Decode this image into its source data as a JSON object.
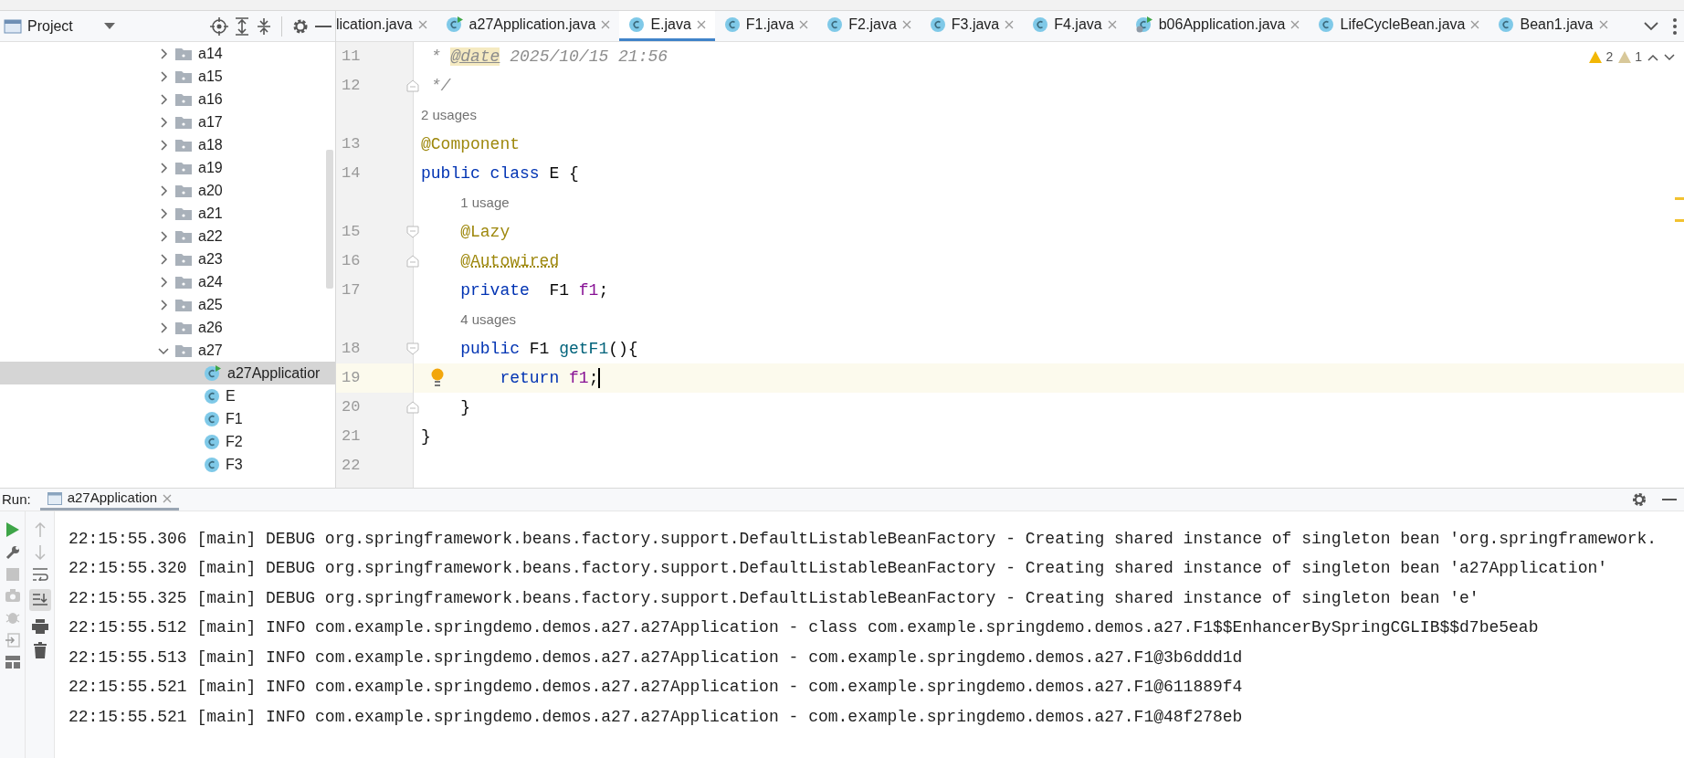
{
  "project": {
    "title": "Project",
    "tree": [
      {
        "label": "a14",
        "kind": "folder",
        "expanded": false,
        "selected": false
      },
      {
        "label": "a15",
        "kind": "folder",
        "expanded": false,
        "selected": false
      },
      {
        "label": "a16",
        "kind": "folder",
        "expanded": false,
        "selected": false
      },
      {
        "label": "a17",
        "kind": "folder",
        "expanded": false,
        "selected": false
      },
      {
        "label": "a18",
        "kind": "folder",
        "expanded": false,
        "selected": false
      },
      {
        "label": "a19",
        "kind": "folder",
        "expanded": false,
        "selected": false
      },
      {
        "label": "a20",
        "kind": "folder",
        "expanded": false,
        "selected": false
      },
      {
        "label": "a21",
        "kind": "folder",
        "expanded": false,
        "selected": false
      },
      {
        "label": "a22",
        "kind": "folder",
        "expanded": false,
        "selected": false
      },
      {
        "label": "a23",
        "kind": "folder",
        "expanded": false,
        "selected": false
      },
      {
        "label": "a24",
        "kind": "folder",
        "expanded": false,
        "selected": false
      },
      {
        "label": "a25",
        "kind": "folder",
        "expanded": false,
        "selected": false
      },
      {
        "label": "a26",
        "kind": "folder",
        "expanded": false,
        "selected": false
      },
      {
        "label": "a27",
        "kind": "folder",
        "expanded": true,
        "selected": false,
        "children": [
          {
            "label": "a27Applicatior",
            "kind": "app",
            "selected": true
          },
          {
            "label": "E",
            "kind": "class",
            "selected": false
          },
          {
            "label": "F1",
            "kind": "class",
            "selected": false
          },
          {
            "label": "F2",
            "kind": "class",
            "selected": false
          },
          {
            "label": "F3",
            "kind": "class",
            "selected": false
          }
        ]
      }
    ]
  },
  "editor": {
    "tabs": [
      {
        "label": "lication.java",
        "kind": "none",
        "selected": false
      },
      {
        "label": "a27Application.java",
        "kind": "app",
        "selected": false
      },
      {
        "label": "E.java",
        "kind": "class",
        "selected": true
      },
      {
        "label": "F1.java",
        "kind": "class",
        "selected": false
      },
      {
        "label": "F2.java",
        "kind": "class",
        "selected": false
      },
      {
        "label": "F3.java",
        "kind": "class",
        "selected": false
      },
      {
        "label": "F4.java",
        "kind": "class",
        "selected": false
      },
      {
        "label": "b06Application.java",
        "kind": "boot-app",
        "selected": false
      },
      {
        "label": "LifeCycleBean.java",
        "kind": "class",
        "selected": false
      },
      {
        "label": "Bean1.java",
        "kind": "class",
        "selected": false
      }
    ],
    "inspections": [
      {
        "kind": "warning",
        "count": "2"
      },
      {
        "kind": "weak",
        "count": "1"
      }
    ],
    "lines": [
      {
        "number": "11",
        "current": false,
        "fold_start": false,
        "fold_end": false,
        "tokens": [
          {
            "kind": "doc",
            "text": " * "
          },
          {
            "kind": "doctag",
            "text": "@date"
          },
          {
            "kind": "doc",
            "text": " 2025/10/15 21:56"
          }
        ]
      },
      {
        "number": "12",
        "current": false,
        "fold_start": false,
        "fold_end": true,
        "tokens": [
          {
            "kind": "doc",
            "text": " */"
          }
        ]
      },
      {
        "number": "13",
        "current": false,
        "fold_start": false,
        "fold_end": false,
        "usages": "2 usages",
        "tokens": [
          {
            "kind": "annotation",
            "text": "@Component"
          }
        ]
      },
      {
        "number": "14",
        "current": false,
        "fold_start": false,
        "fold_end": false,
        "tokens": [
          {
            "kind": "keyword",
            "text": "public class "
          },
          {
            "kind": "plain",
            "text": "E {"
          }
        ]
      },
      {
        "number": "15",
        "current": false,
        "usages": "1 usage",
        "fold_start": true,
        "fold_end": false,
        "tokens": [
          {
            "kind": "annotation",
            "text": "    @Lazy"
          }
        ]
      },
      {
        "number": "16",
        "current": false,
        "fold_start": false,
        "fold_end": true,
        "tokens": [
          {
            "kind": "annotation-typo",
            "text": "    @Autowired"
          }
        ]
      },
      {
        "number": "17",
        "current": false,
        "fold_start": false,
        "fold_end": false,
        "tokens": [
          {
            "kind": "keyword",
            "text": "    private  "
          },
          {
            "kind": "plain",
            "text": "F1 "
          },
          {
            "kind": "field",
            "text": "f1"
          },
          {
            "kind": "plain",
            "text": ";"
          }
        ]
      },
      {
        "number": "18",
        "current": false,
        "usages": "4 usages",
        "fold_start": true,
        "fold_end": false,
        "tokens": [
          {
            "kind": "keyword",
            "text": "    public "
          },
          {
            "kind": "plain",
            "text": "F1 "
          },
          {
            "kind": "method",
            "text": "getF1"
          },
          {
            "kind": "plain",
            "text": "(){"
          }
        ]
      },
      {
        "number": "19",
        "current": true,
        "fold_start": false,
        "fold_end": false,
        "tokens": [
          {
            "kind": "keyword",
            "text": "        return "
          },
          {
            "kind": "field",
            "text": "f1"
          },
          {
            "kind": "plain",
            "text": ";"
          }
        ]
      },
      {
        "number": "20",
        "current": false,
        "fold_start": false,
        "fold_end": true,
        "tokens": [
          {
            "kind": "plain",
            "text": "    }"
          }
        ]
      },
      {
        "number": "21",
        "current": false,
        "fold_start": false,
        "fold_end": false,
        "tokens": [
          {
            "kind": "plain",
            "text": "}"
          }
        ]
      },
      {
        "number": "22",
        "current": false,
        "fold_start": false,
        "fold_end": false
      }
    ]
  },
  "run": {
    "label": "Run:",
    "tabs": [
      {
        "label": "a27Application",
        "selected": true
      }
    ],
    "console": [
      "22:15:55.306 [main] DEBUG org.springframework.beans.factory.support.DefaultListableBeanFactory - Creating shared instance of singleton bean 'org.springframework.",
      "22:15:55.320 [main] DEBUG org.springframework.beans.factory.support.DefaultListableBeanFactory - Creating shared instance of singleton bean 'a27Application'",
      "22:15:55.325 [main] DEBUG org.springframework.beans.factory.support.DefaultListableBeanFactory - Creating shared instance of singleton bean 'e'",
      "22:15:55.512 [main] INFO com.example.springdemo.demos.a27.a27Application - class com.example.springdemo.demos.a27.F1$$EnhancerBySpringCGLIB$$d7be5eab",
      "22:15:55.513 [main] INFO com.example.springdemo.demos.a27.a27Application - com.example.springdemo.demos.a27.F1@3b6ddd1d",
      "22:15:55.521 [main] INFO com.example.springdemo.demos.a27.a27Application - com.example.springdemo.demos.a27.F1@611889f4",
      "22:15:55.521 [main] INFO com.example.springdemo.demos.a27.a27Application - com.example.springdemo.demos.a27.F1@48f278eb"
    ]
  }
}
